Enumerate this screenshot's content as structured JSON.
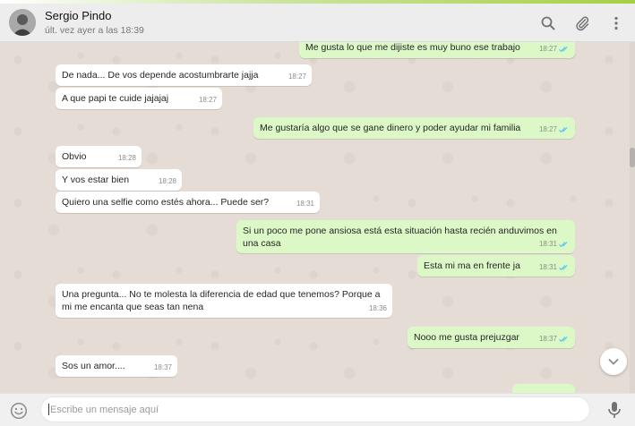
{
  "header": {
    "contact_name": "Sergio Pindo",
    "contact_status": "últ. vez ayer a las 18:39",
    "icons": [
      "search-icon",
      "attach-icon",
      "menu-icon"
    ]
  },
  "messages": [
    {
      "dir": "out",
      "text": "Me gusta lo que me dijiste es muy buno ese trabajo",
      "time": "18:27",
      "read": true
    },
    {
      "dir": "in",
      "text": "De nada... De vos depende acostumbrarte jajja",
      "time": "18:27"
    },
    {
      "dir": "in",
      "text": "A que papi te cuide jajajaj",
      "time": "18:27"
    },
    {
      "dir": "out",
      "text": "Me gustaría algo que se gane dinero y poder ayudar mi familia",
      "time": "18:27",
      "read": true
    },
    {
      "dir": "in",
      "text": "Obvio",
      "time": "18:28"
    },
    {
      "dir": "in",
      "text": "Y vos estar bien",
      "time": "18:28"
    },
    {
      "dir": "in",
      "text": "Quiero una selfie como estés ahora... Puede ser?",
      "time": "18:31"
    },
    {
      "dir": "out",
      "text": "Si un poco me pone ansiosa está esta situación hasta recién anduvimos en una casa",
      "time": "18:31",
      "read": true
    },
    {
      "dir": "out",
      "text": "Esta mi ma en frente ja",
      "time": "18:31",
      "read": true
    },
    {
      "dir": "in",
      "text": "Una pregunta... No te molesta la diferencia de edad que tenemos? Porque a mi me encanta que seas tan nena",
      "time": "18:36"
    },
    {
      "dir": "out",
      "text": "Nooo me gusta prejuzgar",
      "time": "18:37",
      "read": true
    },
    {
      "dir": "in",
      "text": "Sos un amor....",
      "time": "18:37"
    }
  ],
  "composer": {
    "placeholder": "Escribe un mensaje aquí",
    "value": ""
  },
  "colors": {
    "incoming_bubble": "#ffffff",
    "outgoing_bubble": "#dcf8c6",
    "read_ticks": "#4fc3f7",
    "chat_background": "#e5ddd5"
  }
}
